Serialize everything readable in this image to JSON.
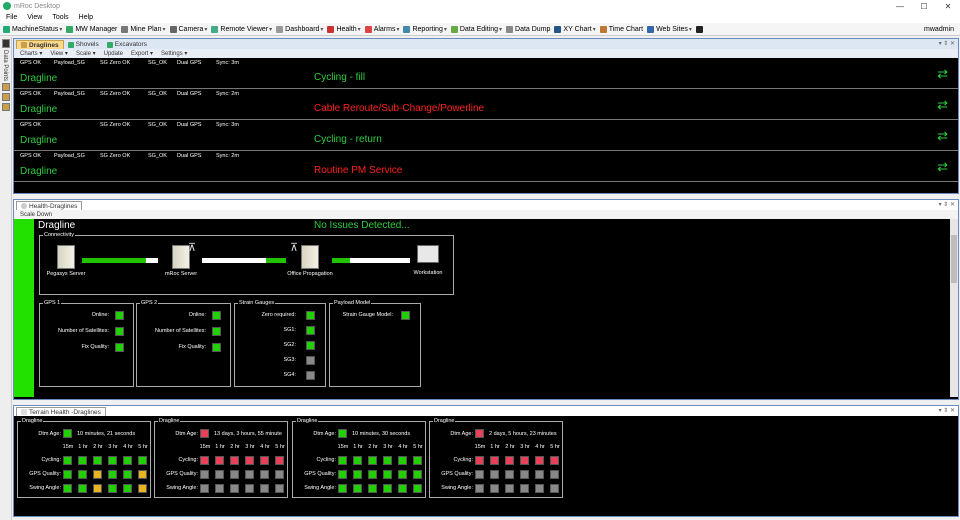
{
  "window": {
    "title": "mRoc Desktop",
    "minimize": "—",
    "maximize": "☐",
    "close": "✕"
  },
  "menu": [
    "File",
    "View",
    "Tools",
    "Help"
  ],
  "toolbar": [
    {
      "label": "MachineStatus",
      "color": "#2a7",
      "dd": true
    },
    {
      "label": "MW Manager",
      "color": "#3a6",
      "dd": false
    },
    {
      "label": "Mine Plan",
      "color": "#777",
      "dd": true
    },
    {
      "label": "Camera",
      "color": "#666",
      "dd": true
    },
    {
      "label": "Remote Viewer",
      "color": "#4a8",
      "dd": true
    },
    {
      "label": "Dashboard",
      "color": "#999",
      "dd": true
    },
    {
      "label": "Health",
      "color": "#c33",
      "dd": true
    },
    {
      "label": "Alarms",
      "color": "#d44",
      "dd": true
    },
    {
      "label": "Reporting",
      "color": "#48a",
      "dd": true
    },
    {
      "label": "Data Editing",
      "color": "#6a4",
      "dd": true
    },
    {
      "label": "Data Dump",
      "color": "#888",
      "dd": false
    },
    {
      "label": "XY Chart",
      "color": "#258",
      "dd": true
    },
    {
      "label": "Time Chart",
      "color": "#b73",
      "dd": false
    },
    {
      "label": "Web Sites",
      "color": "#36a",
      "dd": true
    },
    {
      "label": "",
      "color": "#222",
      "dd": false
    }
  ],
  "user": "mwadmin",
  "left_tabs": {
    "data_points": "Data Points"
  },
  "dragline_panel": {
    "tabs": [
      "Draglines",
      "Shovels",
      "Excavators"
    ],
    "controls": "▾ ⇕ ✕",
    "subtoolbar": [
      "Charts ▾",
      "View ▾",
      "Scale ▾",
      "Update",
      "Export ▾",
      "Settings ▾"
    ],
    "rows": [
      {
        "status": [
          "GPS OK",
          "Payload_SG",
          "SG Zero OK",
          "SG_OK",
          "Dual GPS",
          "Sync: 3m"
        ],
        "name": "Dragline",
        "msg": "Cycling - fill",
        "msg_color": "#2ecc40"
      },
      {
        "status": [
          "GPS OK",
          "Payload_SG",
          "SG Zero OK",
          "SG_OK",
          "Dual GPS",
          "Sync: 2m"
        ],
        "name": "Dragline",
        "msg": "Cable Reroute/Sub-Change/Powerline",
        "msg_color": "#ff2020"
      },
      {
        "status": [
          "GPS OK",
          "",
          "SG Zero OK",
          "SG_OK",
          "Dual GPS",
          "Sync: 3m"
        ],
        "name": "Dragline",
        "msg": "Cycling - return",
        "msg_color": "#2ecc40"
      },
      {
        "status": [
          "GPS OK",
          "Payload_SG",
          "SG Zero OK",
          "SG_OK",
          "Dual GPS",
          "Sync: 2m"
        ],
        "name": "Dragline",
        "msg": "Routine PM Service",
        "msg_color": "#ff2020"
      }
    ],
    "refresh_glyph": "⇄"
  },
  "health_panel": {
    "tab": "Health-Draglines",
    "subtoolbar": "Scale Down",
    "name": "Dragline",
    "message": "No Issues Detected...",
    "connectivity": {
      "legend": "Connectivity",
      "nodes": [
        "Pegasys Server",
        "mRoc Server",
        "Office Propagation",
        "Workstation"
      ]
    },
    "gps1": {
      "legend": "GPS 1",
      "rows": [
        {
          "label": "Online:",
          "state": "g"
        },
        {
          "label": "Number of Satellites:",
          "state": "g"
        },
        {
          "label": "Fix Quality:",
          "state": "g"
        }
      ]
    },
    "gps2": {
      "legend": "GPS 2",
      "rows": [
        {
          "label": "Online:",
          "state": "g"
        },
        {
          "label": "Number of Satellites:",
          "state": "g"
        },
        {
          "label": "Fix Quality:",
          "state": "g"
        }
      ]
    },
    "strain": {
      "legend": "Strain Gauges",
      "rows": [
        {
          "label": "Zero required:",
          "state": "g"
        },
        {
          "label": "SG1:",
          "state": "g"
        },
        {
          "label": "SG2:",
          "state": "g"
        },
        {
          "label": "SG3:",
          "state": "gr"
        },
        {
          "label": "SG4:",
          "state": "gr"
        }
      ]
    },
    "payload": {
      "legend": "Payload Model",
      "rows": [
        {
          "label": "Strain Gauge Model:",
          "state": "g"
        }
      ]
    }
  },
  "terrain_panel": {
    "tab": "Terrain Health -Draglines",
    "col_headers": [
      "15m",
      "1 hr",
      "2 hr",
      "3 hr",
      "4 hr",
      "5 hr"
    ],
    "row_labels": {
      "dtm": "Dtm Age:",
      "cycling": "Cycling:",
      "gps": "GPS Quality:",
      "swing": "Swing Angle:"
    },
    "boxes": [
      {
        "legend": "Dragline",
        "dtm_state": "g",
        "dtm_text": "10 minutes, 21 seconds",
        "cycling": [
          "g",
          "g",
          "g",
          "g",
          "g",
          "g"
        ],
        "gps": [
          "g",
          "g",
          "y",
          "g",
          "g",
          "y"
        ],
        "swing": [
          "g",
          "g",
          "y",
          "g",
          "g",
          "y"
        ]
      },
      {
        "legend": "Dragline",
        "dtm_state": "r",
        "dtm_text": "13 days, 3 hours, 55 minute",
        "cycling": [
          "r",
          "r",
          "r",
          "r",
          "r",
          "r"
        ],
        "gps": [
          "gr",
          "gr",
          "gr",
          "gr",
          "gr",
          "gr"
        ],
        "swing": [
          "gr",
          "gr",
          "gr",
          "gr",
          "gr",
          "gr"
        ]
      },
      {
        "legend": "Dragline",
        "dtm_state": "g",
        "dtm_text": "10 minutes, 30 seconds",
        "cycling": [
          "g",
          "g",
          "g",
          "g",
          "g",
          "g"
        ],
        "gps": [
          "g",
          "g",
          "g",
          "g",
          "g",
          "g"
        ],
        "swing": [
          "g",
          "g",
          "g",
          "g",
          "g",
          "g"
        ]
      },
      {
        "legend": "Dragline",
        "dtm_state": "r",
        "dtm_text": "2 days, 5 hours, 23 minutes",
        "cycling": [
          "r",
          "r",
          "r",
          "r",
          "r",
          "r"
        ],
        "gps": [
          "gr",
          "gr",
          "gr",
          "gr",
          "gr",
          "gr"
        ],
        "swing": [
          "gr",
          "gr",
          "gr",
          "gr",
          "gr",
          "gr"
        ]
      }
    ]
  }
}
